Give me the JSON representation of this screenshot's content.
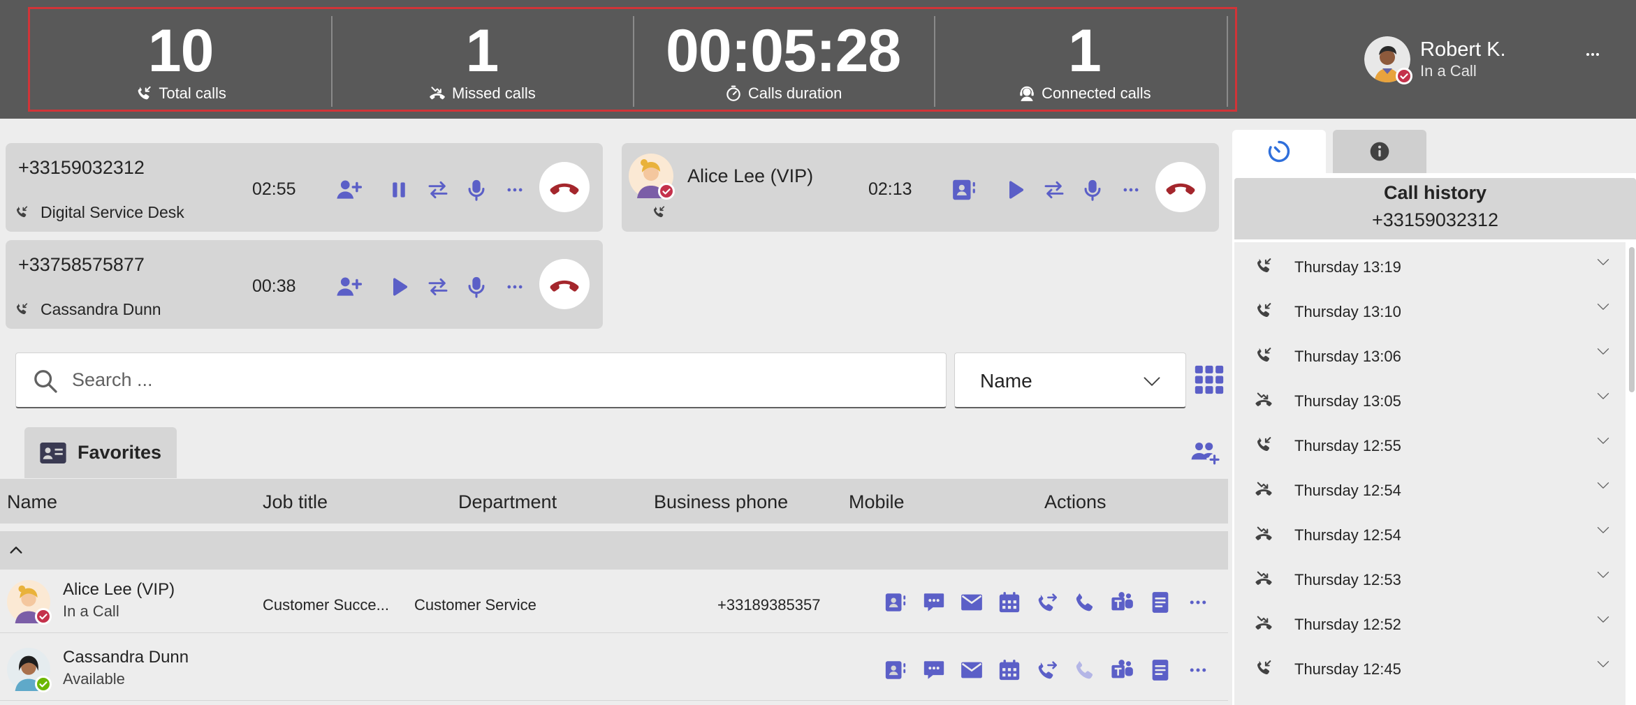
{
  "colors": {
    "header_bg": "#595959",
    "accent": "#5b5fc7",
    "hangup": "#a4262c",
    "highlight_border": "#d13438",
    "presence_busy": "#c4314b",
    "presence_available": "#6bb700"
  },
  "stats": [
    {
      "value": "10",
      "label": "Total calls",
      "icon": "phone-incoming-icon"
    },
    {
      "value": "1",
      "label": "Missed calls",
      "icon": "missed-call-icon"
    },
    {
      "value": "00:05:28",
      "label": "Calls duration",
      "icon": "timer-icon"
    },
    {
      "value": "1",
      "label": "Connected calls",
      "icon": "headset-icon"
    }
  ],
  "user": {
    "name": "Robert K.",
    "status": "In a Call"
  },
  "calls": [
    {
      "number": "+33159032312",
      "name": "Digital Service Desk",
      "timer": "02:55",
      "state": "active"
    },
    {
      "number": "+33758575877",
      "name": "Cassandra Dunn",
      "timer": "00:38",
      "state": "on-hold"
    },
    {
      "number": "Alice Lee (VIP)",
      "name": "",
      "timer": "02:13",
      "state": "on-hold"
    }
  ],
  "search": {
    "placeholder": "Search ..."
  },
  "sort": {
    "selected": "Name"
  },
  "favorites": {
    "label": "Favorites"
  },
  "table": {
    "columns": [
      "Name",
      "Job title",
      "Department",
      "Business phone",
      "Mobile",
      "Actions"
    ],
    "rows": [
      {
        "name": "Alice Lee (VIP)",
        "status": "In a Call",
        "job_title": "Customer Succe...",
        "department": "Customer Service",
        "business_phone": "",
        "mobile": "+33189385357"
      },
      {
        "name": "Cassandra Dunn",
        "status": "Available",
        "job_title": "",
        "department": "",
        "business_phone": "",
        "mobile": ""
      }
    ]
  },
  "history": {
    "title": "Call history",
    "number": "+33159032312",
    "items": [
      {
        "label": "Thursday 13:19",
        "kind": "incoming"
      },
      {
        "label": "Thursday 13:10",
        "kind": "incoming"
      },
      {
        "label": "Thursday 13:06",
        "kind": "incoming"
      },
      {
        "label": "Thursday 13:05",
        "kind": "missed"
      },
      {
        "label": "Thursday 12:55",
        "kind": "incoming"
      },
      {
        "label": "Thursday 12:54",
        "kind": "missed"
      },
      {
        "label": "Thursday 12:54",
        "kind": "missed"
      },
      {
        "label": "Thursday 12:53",
        "kind": "missed"
      },
      {
        "label": "Thursday 12:52",
        "kind": "missed"
      },
      {
        "label": "Thursday 12:45",
        "kind": "incoming"
      }
    ]
  }
}
